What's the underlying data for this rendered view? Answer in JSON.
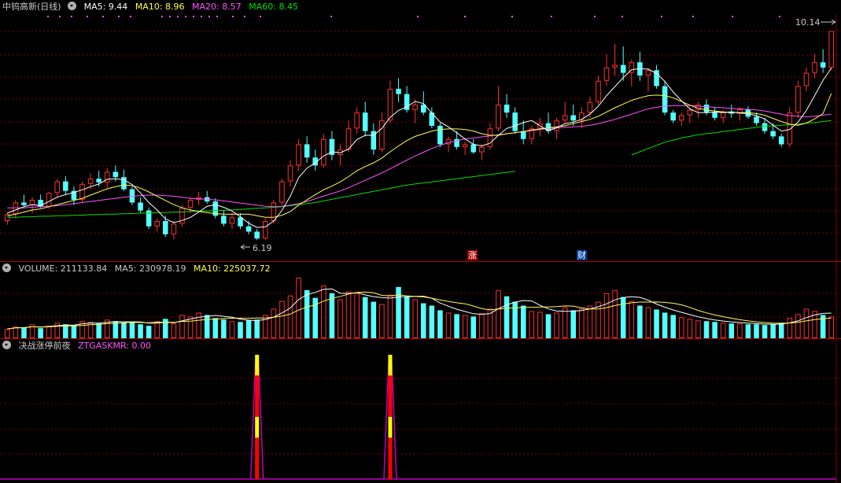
{
  "price_panel": {
    "title": "中钨高新(日线)",
    "ma5": "MA5: 9.44",
    "ma10": "MA10: 8.96",
    "ma20": "MA20: 8.57",
    "ma60": "MA60: 8.45",
    "high_label": "10.14",
    "low_label": "6.19",
    "tag_zhang": "涨",
    "tag_cai": "财"
  },
  "volume_panel": {
    "title": "VOLUME: 211133.84",
    "ma5": "MA5: 230978.19",
    "ma10": "MA10: 225037.72"
  },
  "indicator_panel": {
    "title": "决战涨停前夜",
    "value": "ZTGASKMR: 0.00"
  },
  "colors": {
    "up": "#ff3030",
    "down": "#54ffff",
    "ma5": "#ffffff",
    "ma10": "#ffff54",
    "ma20": "#ff54ff",
    "ma60": "#00e000",
    "grid": "#800000",
    "signal_red": "#ff0000",
    "signal_yellow": "#ffff00",
    "baseline": "#c000c0"
  },
  "chart_data": {
    "type": "candlestick",
    "price_range": [
      6.0,
      10.4
    ],
    "candles": [
      [
        6.55,
        6.72,
        6.48,
        6.68
      ],
      [
        6.68,
        6.95,
        6.6,
        6.9
      ],
      [
        6.9,
        7.05,
        6.82,
        6.85
      ],
      [
        6.85,
        7.0,
        6.7,
        6.95
      ],
      [
        6.95,
        7.05,
        6.8,
        6.82
      ],
      [
        6.82,
        7.1,
        6.78,
        7.08
      ],
      [
        7.08,
        7.35,
        7.0,
        7.3
      ],
      [
        7.3,
        7.4,
        7.05,
        7.12
      ],
      [
        7.12,
        7.2,
        6.85,
        6.95
      ],
      [
        6.95,
        7.3,
        6.9,
        7.25
      ],
      [
        7.25,
        7.45,
        7.15,
        7.35
      ],
      [
        7.35,
        7.5,
        7.2,
        7.28
      ],
      [
        7.28,
        7.55,
        7.18,
        7.48
      ],
      [
        7.48,
        7.6,
        7.3,
        7.38
      ],
      [
        7.38,
        7.52,
        7.12,
        7.15
      ],
      [
        7.15,
        7.2,
        6.85,
        6.9
      ],
      [
        6.9,
        7.0,
        6.7,
        6.75
      ],
      [
        6.75,
        6.8,
        6.4,
        6.45
      ],
      [
        6.45,
        6.6,
        6.35,
        6.55
      ],
      [
        6.55,
        6.65,
        6.25,
        6.3
      ],
      [
        6.3,
        6.55,
        6.2,
        6.5
      ],
      [
        6.5,
        6.85,
        6.45,
        6.8
      ],
      [
        6.8,
        7.0,
        6.7,
        6.95
      ],
      [
        6.95,
        7.1,
        6.85,
        7.0
      ],
      [
        7.0,
        7.12,
        6.88,
        6.92
      ],
      [
        6.92,
        6.98,
        6.6,
        6.65
      ],
      [
        6.65,
        6.75,
        6.45,
        6.5
      ],
      [
        6.5,
        6.7,
        6.4,
        6.62
      ],
      [
        6.62,
        6.7,
        6.4,
        6.45
      ],
      [
        6.45,
        6.55,
        6.3,
        6.35
      ],
      [
        6.35,
        6.4,
        6.19,
        6.22
      ],
      [
        6.22,
        6.6,
        6.19,
        6.55
      ],
      [
        6.55,
        6.95,
        6.5,
        6.9
      ],
      [
        6.9,
        7.35,
        6.85,
        7.3
      ],
      [
        7.3,
        7.7,
        7.2,
        7.6
      ],
      [
        7.6,
        8.1,
        7.5,
        8.0
      ],
      [
        8.0,
        8.15,
        7.65,
        7.75
      ],
      [
        7.75,
        7.9,
        7.5,
        7.6
      ],
      [
        7.6,
        8.2,
        7.55,
        8.1
      ],
      [
        8.1,
        8.25,
        7.7,
        7.8
      ],
      [
        7.8,
        8.0,
        7.6,
        7.9
      ],
      [
        7.9,
        8.45,
        7.85,
        8.3
      ],
      [
        8.3,
        8.7,
        8.2,
        8.6
      ],
      [
        8.6,
        8.8,
        8.15,
        8.25
      ],
      [
        8.25,
        8.4,
        7.8,
        7.9
      ],
      [
        7.9,
        8.6,
        7.85,
        8.45
      ],
      [
        8.45,
        9.2,
        8.4,
        9.05
      ],
      [
        9.05,
        9.25,
        8.8,
        8.95
      ],
      [
        8.95,
        9.1,
        8.6,
        8.65
      ],
      [
        8.65,
        8.85,
        8.4,
        8.75
      ],
      [
        8.75,
        9.0,
        8.55,
        8.6
      ],
      [
        8.6,
        8.7,
        8.3,
        8.35
      ],
      [
        8.35,
        8.4,
        7.95,
        8.0
      ],
      [
        8.0,
        8.15,
        7.85,
        8.1
      ],
      [
        8.1,
        8.25,
        7.9,
        7.95
      ],
      [
        7.95,
        8.05,
        7.8,
        8.0
      ],
      [
        8.0,
        8.1,
        7.82,
        7.85
      ],
      [
        7.85,
        8.0,
        7.7,
        7.95
      ],
      [
        7.95,
        8.4,
        7.9,
        8.3
      ],
      [
        8.3,
        9.1,
        8.25,
        8.75
      ],
      [
        8.75,
        8.95,
        8.5,
        8.6
      ],
      [
        8.6,
        8.7,
        8.2,
        8.25
      ],
      [
        8.25,
        8.45,
        8.0,
        8.1
      ],
      [
        8.1,
        8.35,
        8.0,
        8.3
      ],
      [
        8.3,
        8.5,
        8.15,
        8.4
      ],
      [
        8.4,
        8.6,
        8.2,
        8.25
      ],
      [
        8.25,
        8.5,
        8.1,
        8.45
      ],
      [
        8.45,
        8.8,
        8.4,
        8.55
      ],
      [
        8.55,
        8.75,
        8.35,
        8.45
      ],
      [
        8.45,
        8.7,
        8.3,
        8.6
      ],
      [
        8.6,
        8.9,
        8.5,
        8.8
      ],
      [
        8.8,
        9.3,
        8.75,
        9.2
      ],
      [
        9.2,
        9.7,
        9.1,
        9.45
      ],
      [
        9.45,
        9.9,
        9.3,
        9.5
      ],
      [
        9.5,
        9.85,
        9.2,
        9.35
      ],
      [
        9.35,
        9.6,
        9.1,
        9.55
      ],
      [
        9.55,
        9.75,
        9.2,
        9.3
      ],
      [
        9.3,
        9.45,
        9.0,
        9.4
      ],
      [
        9.4,
        9.5,
        9.05,
        9.1
      ],
      [
        9.1,
        9.2,
        8.55,
        8.6
      ],
      [
        8.6,
        8.65,
        8.4,
        8.45
      ],
      [
        8.45,
        8.6,
        8.35,
        8.55
      ],
      [
        8.55,
        8.7,
        8.4,
        8.65
      ],
      [
        8.65,
        8.8,
        8.5,
        8.75
      ],
      [
        8.75,
        8.85,
        8.55,
        8.6
      ],
      [
        8.6,
        8.7,
        8.45,
        8.5
      ],
      [
        8.5,
        8.65,
        8.4,
        8.62
      ],
      [
        8.62,
        8.75,
        8.5,
        8.58
      ],
      [
        8.58,
        8.7,
        8.45,
        8.66
      ],
      [
        8.66,
        8.72,
        8.48,
        8.52
      ],
      [
        8.52,
        8.6,
        8.35,
        8.4
      ],
      [
        8.4,
        8.5,
        8.2,
        8.25
      ],
      [
        8.25,
        8.4,
        8.1,
        8.15
      ],
      [
        8.15,
        8.2,
        7.95,
        8.0
      ],
      [
        8.0,
        8.7,
        7.95,
        8.6
      ],
      [
        8.6,
        9.2,
        8.5,
        9.1
      ],
      [
        9.1,
        9.45,
        9.0,
        9.35
      ],
      [
        9.35,
        9.7,
        9.25,
        9.55
      ],
      [
        9.55,
        9.8,
        9.35,
        9.45
      ],
      [
        9.45,
        10.14,
        9.4,
        10.14
      ]
    ],
    "ma5": [
      6.7,
      6.76,
      6.82,
      6.86,
      6.84,
      6.92,
      7.0,
      7.05,
      7.09,
      7.14,
      7.2,
      7.25,
      7.34,
      7.35,
      7.33,
      7.24,
      7.08,
      6.9,
      6.76,
      6.59,
      6.52,
      6.56,
      6.62,
      6.72,
      6.83,
      6.86,
      6.81,
      6.74,
      6.63,
      6.51,
      6.43,
      6.44,
      6.55,
      6.75,
      7.02,
      7.37,
      7.55,
      7.65,
      7.78,
      7.86,
      7.84,
      7.91,
      8.09,
      8.17,
      8.17,
      8.3,
      8.51,
      8.64,
      8.71,
      8.81,
      8.77,
      8.59,
      8.42,
      8.33,
      8.22,
      8.1,
      8.0,
      7.97,
      8.02,
      8.17,
      8.3,
      8.35,
      8.41,
      8.45,
      8.35,
      8.26,
      8.31,
      8.39,
      8.42,
      8.47,
      8.57,
      8.72,
      8.92,
      9.09,
      9.26,
      9.41,
      9.43,
      9.42,
      9.34,
      9.19,
      8.99,
      8.82,
      8.67,
      8.6,
      8.6,
      8.61,
      8.6,
      8.61,
      8.59,
      8.58,
      8.54,
      8.48,
      8.36,
      8.25,
      8.28,
      8.42,
      8.64,
      8.92,
      9.21,
      9.44
    ],
    "ma10": [
      6.65,
      6.68,
      6.72,
      6.76,
      6.78,
      6.82,
      6.86,
      6.9,
      6.94,
      6.98,
      7.04,
      7.1,
      7.16,
      7.2,
      7.23,
      7.22,
      7.17,
      7.1,
      7.02,
      6.94,
      6.86,
      6.8,
      6.76,
      6.73,
      6.71,
      6.69,
      6.68,
      6.68,
      6.68,
      6.68,
      6.65,
      6.62,
      6.62,
      6.66,
      6.73,
      6.85,
      6.95,
      7.05,
      7.14,
      7.21,
      7.29,
      7.39,
      7.5,
      7.58,
      7.65,
      7.74,
      7.86,
      7.97,
      8.07,
      8.15,
      8.2,
      8.25,
      8.28,
      8.29,
      8.29,
      8.28,
      8.25,
      8.2,
      8.17,
      8.17,
      8.2,
      8.22,
      8.24,
      8.27,
      8.29,
      8.31,
      8.33,
      8.35,
      8.39,
      8.43,
      8.47,
      8.53,
      8.61,
      8.69,
      8.76,
      8.83,
      8.88,
      8.92,
      8.93,
      8.92,
      8.88,
      8.81,
      8.74,
      8.68,
      8.65,
      8.63,
      8.61,
      8.6,
      8.6,
      8.6,
      8.58,
      8.55,
      8.49,
      8.43,
      8.38,
      8.36,
      8.4,
      8.48,
      8.58,
      8.96
    ],
    "ma20": [
      6.8,
      6.8,
      6.8,
      6.81,
      6.82,
      6.83,
      6.84,
      6.86,
      6.88,
      6.9,
      6.92,
      6.94,
      6.96,
      6.98,
      7.0,
      7.02,
      7.03,
      7.04,
      7.04,
      7.03,
      7.02,
      7.0,
      6.98,
      6.97,
      6.96,
      6.95,
      6.93,
      6.91,
      6.89,
      6.87,
      6.85,
      6.83,
      6.82,
      6.83,
      6.85,
      6.88,
      6.92,
      6.97,
      7.02,
      7.07,
      7.12,
      7.18,
      7.25,
      7.32,
      7.39,
      7.46,
      7.54,
      7.62,
      7.7,
      7.78,
      7.85,
      7.92,
      7.98,
      8.03,
      8.07,
      8.1,
      8.12,
      8.14,
      8.16,
      8.18,
      8.2,
      8.22,
      8.24,
      8.26,
      8.28,
      8.3,
      8.31,
      8.32,
      8.33,
      8.34,
      8.36,
      8.39,
      8.43,
      8.47,
      8.52,
      8.57,
      8.62,
      8.67,
      8.7,
      8.72,
      8.73,
      8.73,
      8.73,
      8.72,
      8.71,
      8.7,
      8.69,
      8.68,
      8.67,
      8.66,
      8.65,
      8.63,
      8.6,
      8.57,
      8.54,
      8.53,
      8.52,
      8.53,
      8.55,
      8.57
    ],
    "ma60_start": 0,
    "ma60": [
      6.62,
      6.62,
      6.63,
      6.63,
      6.64,
      6.64,
      6.65,
      6.65,
      6.66,
      6.66,
      6.67,
      6.67,
      6.68,
      6.68,
      6.69,
      6.69,
      6.7,
      6.7,
      6.71,
      6.71,
      6.72,
      6.72,
      6.73,
      6.74,
      6.74,
      6.75,
      6.75,
      6.76,
      6.77,
      6.78,
      6.79,
      6.8,
      6.81,
      6.82,
      6.84,
      6.86,
      6.88,
      6.9,
      6.93,
      6.96,
      6.99,
      7.02,
      7.05,
      7.08,
      7.11,
      7.14,
      7.17,
      7.2,
      7.23,
      7.25,
      7.27,
      7.29,
      7.31,
      7.33,
      7.35,
      7.37,
      7.39,
      7.41,
      7.43,
      7.45,
      7.47,
      7.49,
      null,
      null,
      null,
      null,
      null,
      null,
      null,
      null,
      null,
      null,
      null,
      null,
      null,
      7.8,
      7.86,
      7.92,
      7.98,
      8.04,
      8.08,
      8.12,
      8.15,
      8.18,
      8.2,
      8.22,
      8.24,
      8.26,
      8.28,
      8.3,
      8.32,
      8.34,
      8.35,
      8.36,
      8.37,
      8.38,
      8.4,
      8.41,
      8.43,
      8.45
    ],
    "volume": [
      12,
      15,
      14,
      18,
      13,
      16,
      20,
      18,
      17,
      22,
      21,
      19,
      24,
      22,
      20,
      21,
      18,
      16,
      22,
      25,
      19,
      30,
      28,
      33,
      30,
      26,
      24,
      22,
      21,
      23,
      24,
      30,
      38,
      48,
      55,
      78,
      62,
      52,
      68,
      58,
      50,
      60,
      58,
      53,
      47,
      44,
      56,
      66,
      54,
      50,
      45,
      42,
      36,
      33,
      31,
      30,
      28,
      32,
      38,
      62,
      54,
      47,
      42,
      35,
      34,
      31,
      33,
      40,
      36,
      38,
      42,
      47,
      58,
      62,
      53,
      48,
      42,
      40,
      37,
      33,
      30,
      27,
      25,
      23,
      22,
      21,
      20,
      19,
      19,
      18,
      18,
      17,
      18,
      20,
      26,
      31,
      38,
      35,
      30,
      28
    ],
    "vol_range": [
      0,
      82
    ],
    "signals": [
      {
        "index": 30,
        "height": 1.0
      },
      {
        "index": 46,
        "height": 1.0
      }
    ]
  }
}
